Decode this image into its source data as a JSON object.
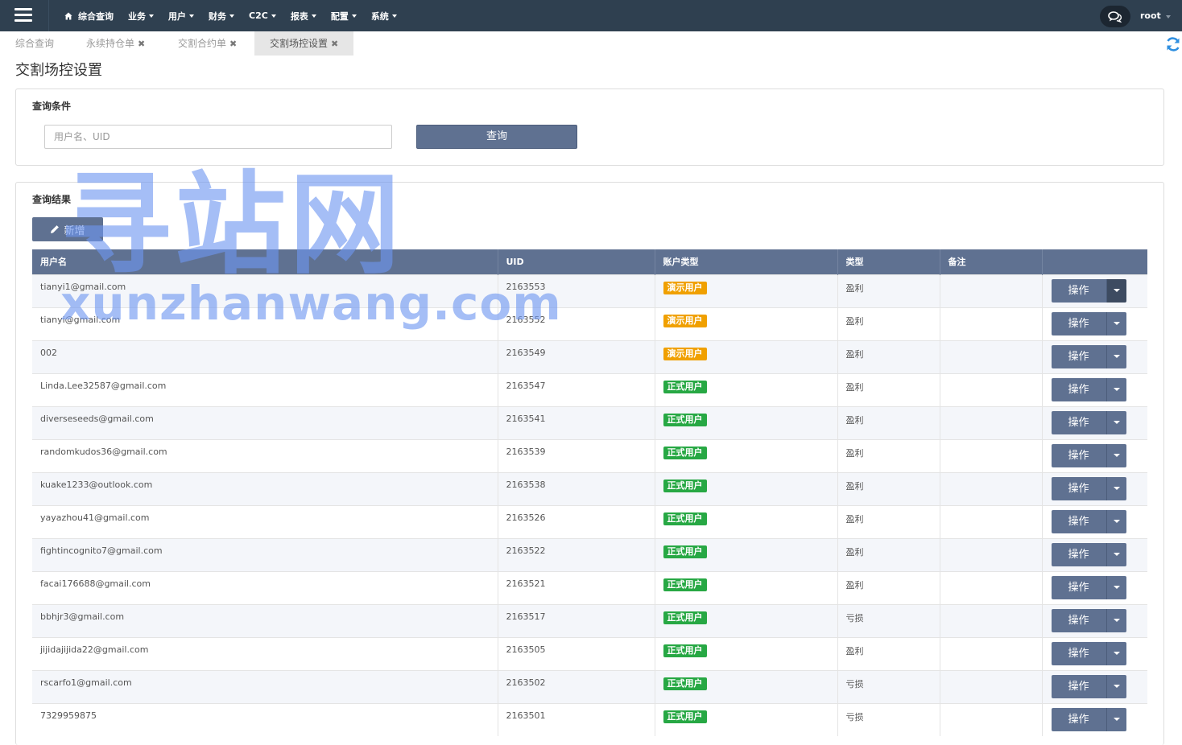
{
  "nav": {
    "items": [
      {
        "label": "综合查询",
        "has_icon": "home-icon",
        "dropdown": false
      },
      {
        "label": "业务",
        "dropdown": true
      },
      {
        "label": "用户",
        "dropdown": true
      },
      {
        "label": "财务",
        "dropdown": true
      },
      {
        "label": "C2C",
        "dropdown": true
      },
      {
        "label": "报表",
        "dropdown": true
      },
      {
        "label": "配置",
        "dropdown": true
      },
      {
        "label": "系统",
        "dropdown": true
      }
    ],
    "user": "root"
  },
  "tabs": [
    {
      "label": "综合查询",
      "closable": false,
      "active": false
    },
    {
      "label": "永续持仓单",
      "closable": true,
      "active": false
    },
    {
      "label": "交割合约单",
      "closable": true,
      "active": false
    },
    {
      "label": "交割场控设置",
      "closable": true,
      "active": true
    }
  ],
  "page": {
    "title": "交割场控设置"
  },
  "query": {
    "heading": "查询条件",
    "placeholder": "用户名、UID",
    "value": "",
    "button": "查询"
  },
  "results": {
    "heading": "查询结果",
    "add_button": "新增",
    "columns": [
      "用户名",
      "UID",
      "账户类型",
      "类型",
      "备注",
      ""
    ],
    "action_label": "操作",
    "rows": [
      {
        "username": "tianyi1@gmail.com",
        "uid": "2163553",
        "account_type": "演示用户",
        "kind": "demo",
        "type": "盈利",
        "note": ""
      },
      {
        "username": "tianyi@gmail.com",
        "uid": "2163552",
        "account_type": "演示用户",
        "kind": "demo",
        "type": "盈利",
        "note": ""
      },
      {
        "username": "002",
        "uid": "2163549",
        "account_type": "演示用户",
        "kind": "demo",
        "type": "盈利",
        "note": ""
      },
      {
        "username": "Linda.Lee32587@gmail.com",
        "uid": "2163547",
        "account_type": "正式用户",
        "kind": "real",
        "type": "盈利",
        "note": ""
      },
      {
        "username": "diverseseeds@gmail.com",
        "uid": "2163541",
        "account_type": "正式用户",
        "kind": "real",
        "type": "盈利",
        "note": ""
      },
      {
        "username": "randomkudos36@gmail.com",
        "uid": "2163539",
        "account_type": "正式用户",
        "kind": "real",
        "type": "盈利",
        "note": ""
      },
      {
        "username": "kuake1233@outlook.com",
        "uid": "2163538",
        "account_type": "正式用户",
        "kind": "real",
        "type": "盈利",
        "note": ""
      },
      {
        "username": "yayazhou41@gmail.com",
        "uid": "2163526",
        "account_type": "正式用户",
        "kind": "real",
        "type": "盈利",
        "note": ""
      },
      {
        "username": "fightincognito7@gmail.com",
        "uid": "2163522",
        "account_type": "正式用户",
        "kind": "real",
        "type": "盈利",
        "note": ""
      },
      {
        "username": "facai176688@gmail.com",
        "uid": "2163521",
        "account_type": "正式用户",
        "kind": "real",
        "type": "盈利",
        "note": ""
      },
      {
        "username": "bbhjr3@gmail.com",
        "uid": "2163517",
        "account_type": "正式用户",
        "kind": "real",
        "type": "亏损",
        "note": ""
      },
      {
        "username": "jijidajijida22@gmail.com",
        "uid": "2163505",
        "account_type": "正式用户",
        "kind": "real",
        "type": "盈利",
        "note": ""
      },
      {
        "username": "rscarfo1@gmail.com",
        "uid": "2163502",
        "account_type": "正式用户",
        "kind": "real",
        "type": "亏损",
        "note": ""
      },
      {
        "username": "7329959875",
        "uid": "2163501",
        "account_type": "正式用户",
        "kind": "real",
        "type": "亏损",
        "note": ""
      }
    ]
  },
  "watermark": {
    "main": "寻站网",
    "sub": "xunzhanwang.com"
  },
  "colors": {
    "topbar": "#2f4050",
    "primary": "#5f7191",
    "demo_badge": "#f0a000",
    "real_badge": "#27a844"
  }
}
